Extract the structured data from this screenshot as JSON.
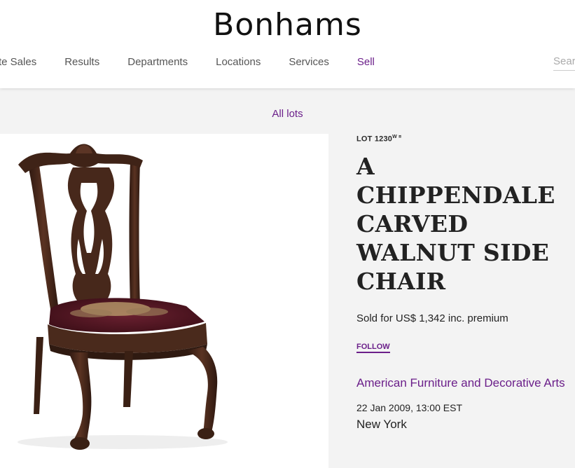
{
  "brand": {
    "name": "Bonhams"
  },
  "nav": {
    "items": [
      {
        "label": "te Sales"
      },
      {
        "label": "Results"
      },
      {
        "label": "Departments"
      },
      {
        "label": "Locations"
      },
      {
        "label": "Services"
      },
      {
        "label": "Sell"
      }
    ],
    "search_placeholder": "Search"
  },
  "breadcrumb": {
    "all_lots": "All lots"
  },
  "lot": {
    "number": "LOT 1230",
    "superscript": "W ¤",
    "title": "A CHIPPENDALE CARVED WALNUT SIDE CHAIR",
    "sold_text": "Sold for US$ 1,342 inc. premium",
    "follow_label": "FOLLOW"
  },
  "sale": {
    "name": "American Furniture and Decorative Arts",
    "date": "22 Jan 2009, 13:00 EST",
    "location": "New York"
  },
  "colors": {
    "accent": "#6b1f8a",
    "walnut": "#4a2a1c",
    "cushion": "#5a1a26"
  }
}
